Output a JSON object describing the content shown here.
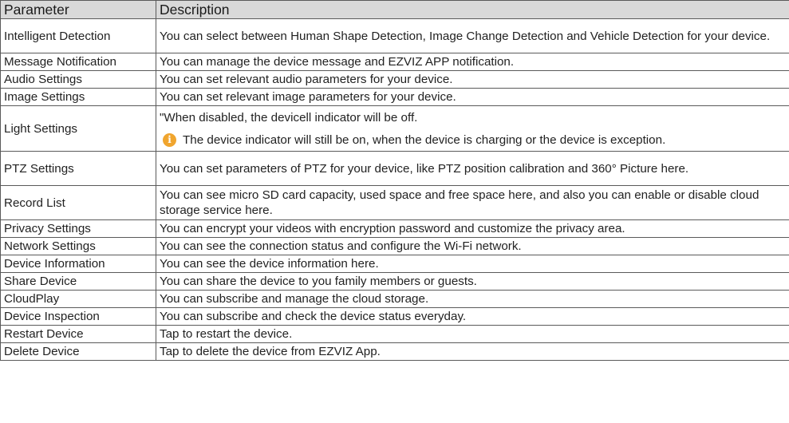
{
  "table": {
    "headers": {
      "parameter": "Parameter",
      "description": "Description"
    },
    "rows": [
      {
        "parameter": "Intelligent Detection",
        "description": "You can select between Human Shape Detection, Image Change Detection and Vehicle Detection for your device."
      },
      {
        "parameter": "Message Notification",
        "description": "You can manage the device message and EZVIZ APP notification."
      },
      {
        "parameter": "Audio Settings",
        "description": "You can set relevant audio parameters for your device."
      },
      {
        "parameter": "Image Settings",
        "description": "You can set relevant image parameters for your device."
      },
      {
        "parameter": "Light Settings",
        "description": "\"When disabled, the devicell indicator will be off.",
        "note": "The device indicator will still be on, when the device is charging or the device is exception."
      },
      {
        "parameter": "PTZ Settings",
        "description": "You can set parameters of PTZ for your device, like PTZ position calibration and 360° Picture here."
      },
      {
        "parameter": "Record List",
        "description": "You can see micro SD card capacity, used space and free space here, and also you can enable or disable cloud storage service here."
      },
      {
        "parameter": "Privacy Settings",
        "description": "You can encrypt your videos with encryption password and customize the privacy area."
      },
      {
        "parameter": "Network Settings",
        "description": "You can see the connection status and configure the Wi-Fi network."
      },
      {
        "parameter": "Device Information",
        "description": "You can see the device information here."
      },
      {
        "parameter": "Share Device",
        "description": "You can share the device to you family members or guests."
      },
      {
        "parameter": "CloudPlay",
        "description": "You can subscribe and manage the cloud storage."
      },
      {
        "parameter": "Device Inspection",
        "description": "You can subscribe and check the device status everyday."
      },
      {
        "parameter": "Restart Device",
        "description": "Tap to restart the device."
      },
      {
        "parameter": "Delete Device",
        "description": "Tap to delete the device from EZVIZ App."
      }
    ],
    "note_icon": "info-icon",
    "note_icon_color": "#f0a52e",
    "header_background": "#d9d9d9",
    "border_color": "#5a5a5a"
  }
}
